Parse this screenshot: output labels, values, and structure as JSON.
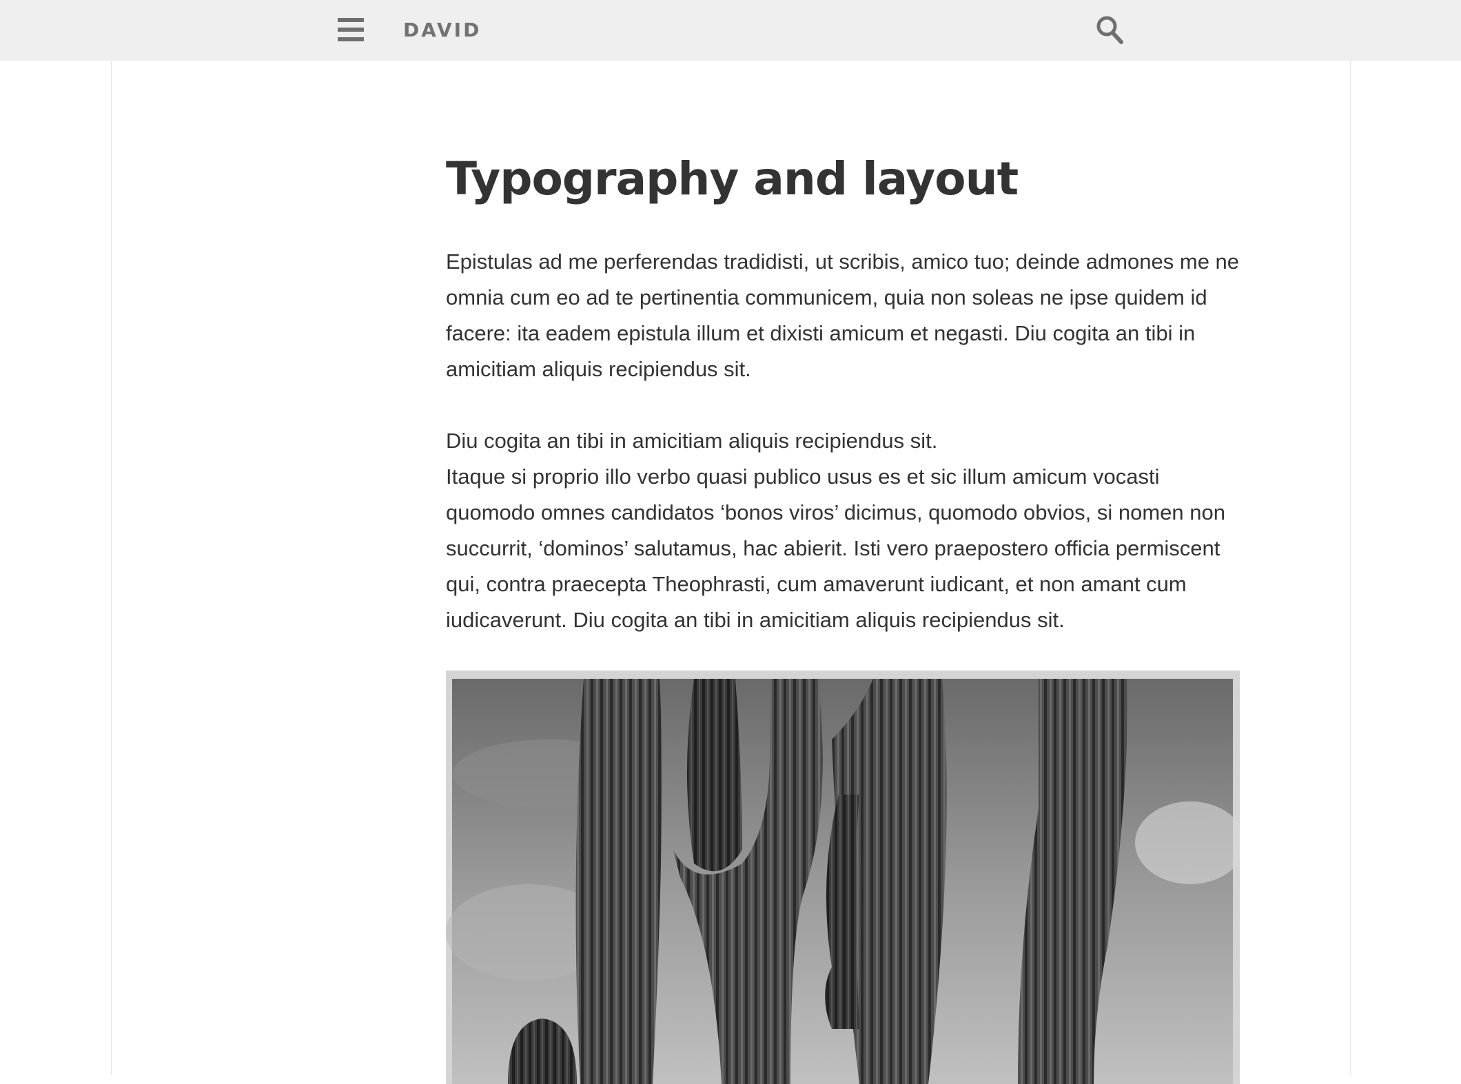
{
  "header": {
    "menu_icon": "hamburger-menu-icon",
    "site_title": "DAVID",
    "search_icon": "search-icon",
    "background": "#efefef"
  },
  "article": {
    "title": "Typography and layout",
    "paragraph_1": "Epistulas ad me perferendas tradidisti, ut scribis, amico tuo; deinde admones me ne omnia cum eo ad te pertinentia communicem, quia non soleas ne ipse quidem id facere: ita eadem epistula illum et dixisti amicum et negasti. Diu cogita an tibi in amicitiam aliquis recipiendus sit.",
    "paragraph_2_line_1": "Diu cogita an tibi in amicitiam aliquis recipiendus sit.",
    "paragraph_2_rest": "Itaque si proprio illo verbo quasi publico usus es et sic illum amicum vocasti quomodo omnes candidatos ‘bonos viros’ dicimus, quomodo obvios, si nomen non succurrit, ‘dominos’ salutamus, hac abierit. Isti vero praepostero officia permiscent qui, contra praecepta Theophrasti, cum amaverunt iudicant, et non amant cum iudicaverunt. Diu cogita an tibi in amicitiam aliquis recipiendus sit.",
    "image": {
      "subject": "black-and-white photograph of saguaro cacti against a cloudy sky"
    }
  }
}
